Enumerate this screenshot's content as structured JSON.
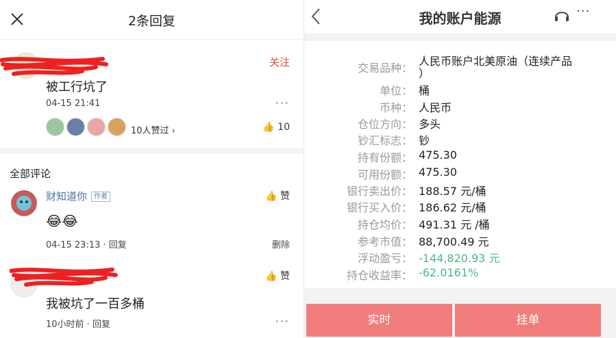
{
  "left": {
    "header_title": "2条回复",
    "post": {
      "follow_label": "关注",
      "content": "被工行坑了",
      "timestamp": "04-15 21:41",
      "more": "···",
      "likes_text": "10人赞过 ›",
      "like_count": "10"
    },
    "section_title": "全部评论",
    "comments": [
      {
        "username": "财知道你",
        "badge": "作者",
        "content": "😂😂",
        "meta": "04-15 23:13 · 回复",
        "action": "删除",
        "like_label": "赞"
      },
      {
        "content": "我被坑了一百多桶",
        "meta": "10小时前 · 回复",
        "more": "···",
        "like_label": "赞"
      }
    ]
  },
  "right": {
    "header_title": "我的账户能源",
    "more": "···",
    "fields": [
      {
        "label": "交易品种：",
        "value": "人民币账户北美原油（连续产品"
      },
      {
        "label": "",
        "value": "）"
      },
      {
        "label": "单位：",
        "value": "桶"
      },
      {
        "label": "币种：",
        "value": "人民币"
      },
      {
        "label": "仓位方向：",
        "value": "多头"
      },
      {
        "label": "钞汇标志：",
        "value": "钞"
      },
      {
        "label": "持有份额：",
        "value": "475.30"
      },
      {
        "label": "可用份额：",
        "value": "475.30"
      },
      {
        "label": "银行卖出价：",
        "value": "188.57 元/桶"
      },
      {
        "label": "银行买入价：",
        "value": "186.62 元/桶"
      },
      {
        "label": "持仓均价：",
        "value": "491.31 元 /桶"
      },
      {
        "label": "参考市值：",
        "value": "88,700.49 元"
      },
      {
        "label": "浮动盈亏：",
        "value": "-144,820.93 元"
      },
      {
        "label": "持仓收益率：",
        "value": "-62.0161%"
      }
    ],
    "buttons": {
      "realtime": "实时",
      "order": "挂单"
    }
  },
  "colors": {
    "accent_red": "#e84646",
    "button_red": "#f17c7c",
    "loss_green": "#49b985",
    "link_blue": "#4a6fa5"
  }
}
